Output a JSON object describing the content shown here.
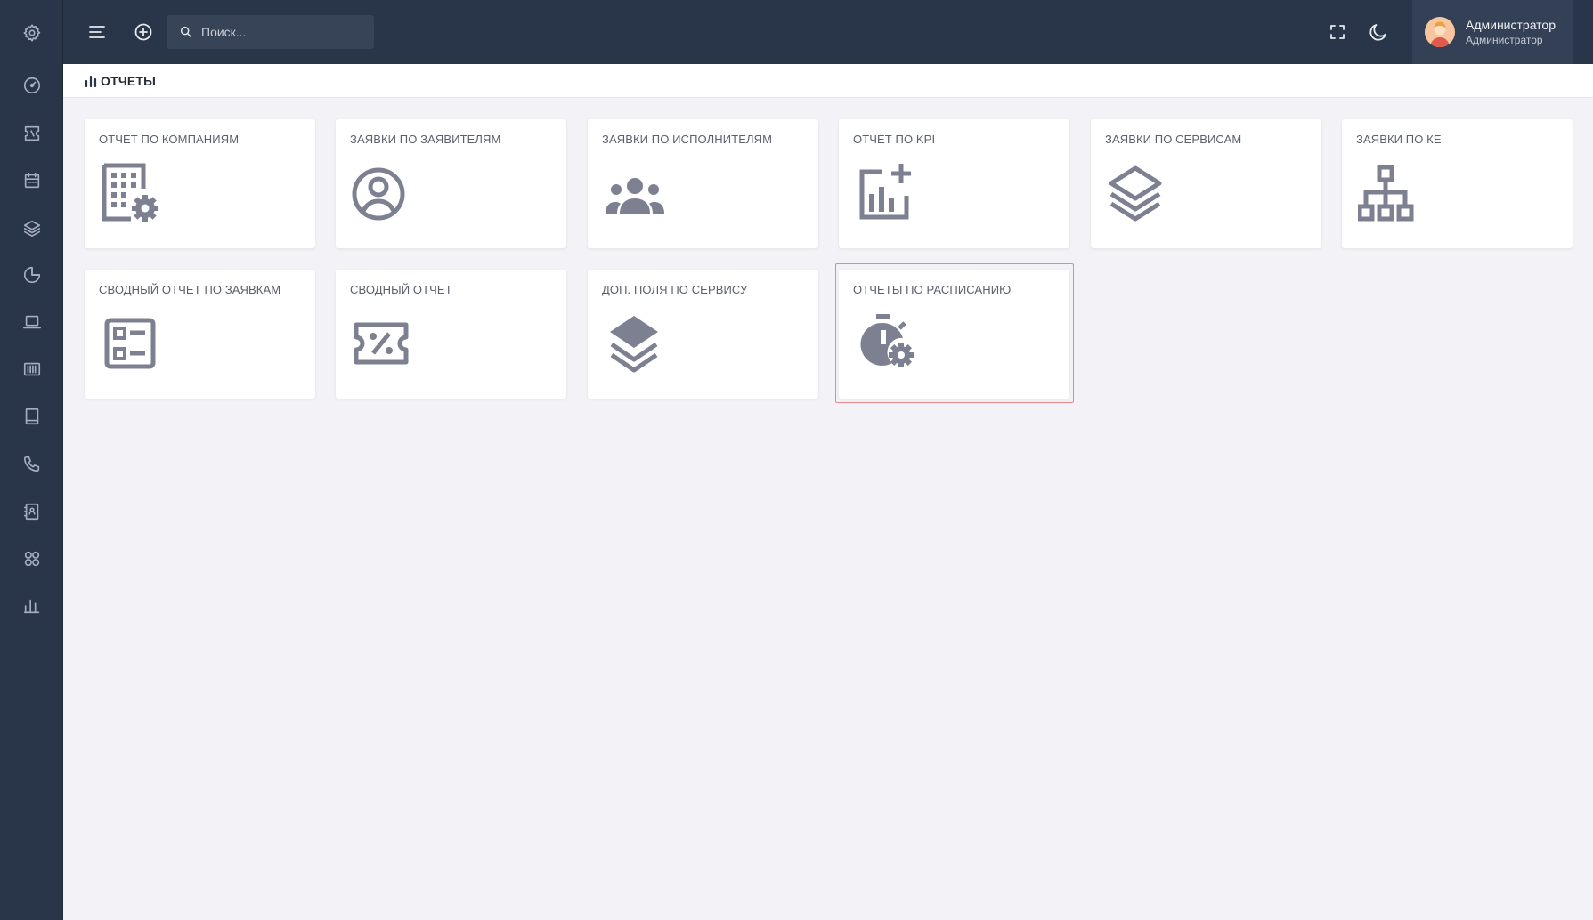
{
  "sidebar": {
    "items": [
      {
        "name": "settings-icon"
      },
      {
        "name": "dashboard-icon"
      },
      {
        "name": "ticket-icon"
      },
      {
        "name": "calendar-icon"
      },
      {
        "name": "layers-icon"
      },
      {
        "name": "pie-chart-icon"
      },
      {
        "name": "laptop-icon"
      },
      {
        "name": "barcode-icon"
      },
      {
        "name": "book-icon"
      },
      {
        "name": "phone-icon"
      },
      {
        "name": "contacts-icon"
      },
      {
        "name": "apps-icon"
      },
      {
        "name": "bar-chart-icon"
      }
    ]
  },
  "header": {
    "search_placeholder": "Поиск...",
    "user_name": "Администратор",
    "user_role": "Администратор"
  },
  "page": {
    "title": "ОТЧЕТЫ"
  },
  "reports": [
    {
      "label": "ОТЧЕТ ПО КОМПАНИЯМ",
      "icon": "building-gear-icon"
    },
    {
      "label": "ЗАЯВКИ ПО ЗАЯВИТЕЛЯМ",
      "icon": "user-circle-icon"
    },
    {
      "label": "ЗАЯВКИ ПО ИСПОЛНИТЕЛЯМ",
      "icon": "group-icon"
    },
    {
      "label": "ОТЧЕТ ПО KPI",
      "icon": "chart-add-icon"
    },
    {
      "label": "ЗАЯВКИ ПО СЕРВИСАМ",
      "icon": "layers-outline-icon"
    },
    {
      "label": "ЗАЯВКИ ПО КЕ",
      "icon": "hierarchy-icon"
    },
    {
      "label": "СВОДНЫЙ ОТЧЕТ ПО ЗАЯВКАМ",
      "icon": "checklist-icon"
    },
    {
      "label": "СВОДНЫЙ ОТЧЕТ",
      "icon": "discount-ticket-icon"
    },
    {
      "label": "ДОП. ПОЛЯ ПО СЕРВИСУ",
      "icon": "layers-filled-icon"
    },
    {
      "label": "ОТЧЕТЫ ПО РАСПИСАНИЮ",
      "icon": "timer-gear-icon"
    }
  ],
  "colors": {
    "sidebar_bg": "#293548",
    "card_icon": "#7c8090",
    "highlight_border": "#e8878e"
  }
}
